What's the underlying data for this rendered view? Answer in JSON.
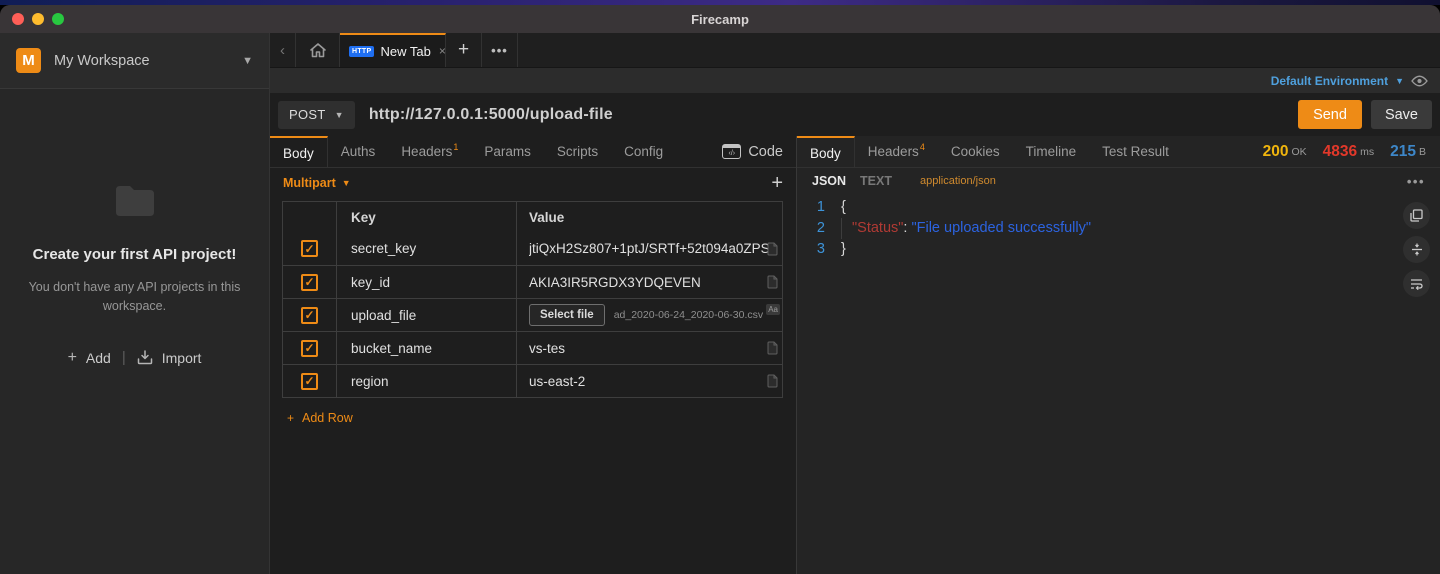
{
  "colors": {
    "accent_orange": "#ee8b16",
    "status_ok_yellow": "#f0b50d",
    "status_time_red": "#e2382a",
    "status_size_blue": "#3d87c9",
    "env_blue": "#4fa0dd",
    "http_badge_blue": "#1f6ff2",
    "json_key_red": "#b03a34",
    "json_string_blue": "#2c63e0",
    "line_number_blue": "#3d93d8"
  },
  "window": {
    "title": "Firecamp"
  },
  "sidebar": {
    "workspace_initial": "M",
    "workspace_name": "My Workspace",
    "empty_title": "Create your first API project!",
    "empty_subtitle": "You don't have any API projects in this workspace.",
    "add_label": "Add",
    "import_label": "Import"
  },
  "tabbar": {
    "active_tab": {
      "badge": "HTTP",
      "label": "New Tab",
      "close": "×"
    }
  },
  "envbar": {
    "selected": "Default Environment"
  },
  "requestbar": {
    "method": "POST",
    "url": "http://127.0.0.1:5000/upload-file",
    "send": "Send",
    "save": "Save"
  },
  "request": {
    "tabs": [
      {
        "label": "Body",
        "active": true
      },
      {
        "label": "Auths"
      },
      {
        "label": "Headers",
        "sup": "1"
      },
      {
        "label": "Params"
      },
      {
        "label": "Scripts"
      },
      {
        "label": "Config"
      }
    ],
    "code_button": "Code",
    "body_type": "Multipart",
    "table": {
      "col_key": "Key",
      "col_value": "Value",
      "rows": [
        {
          "checked": true,
          "key": "secret_key",
          "value": "jtiQxH2Sz807+1ptJ/SRTf+52t094a0ZPS",
          "icon": "doc"
        },
        {
          "checked": true,
          "key": "key_id",
          "value": "AKIA3IR5RGDX3YDQEVEN",
          "icon": "doc"
        },
        {
          "checked": true,
          "key": "upload_file",
          "file_button": "Select file",
          "file_name": "ad_2020-06-24_2020-06-30.csv",
          "icon": "Aa"
        },
        {
          "checked": true,
          "key": "bucket_name",
          "value": "vs-tes",
          "icon": "doc"
        },
        {
          "checked": true,
          "key": "region",
          "value": "us-east-2",
          "icon": "doc"
        }
      ]
    },
    "add_row": "Add Row"
  },
  "response": {
    "tabs": [
      {
        "label": "Body",
        "active": true
      },
      {
        "label": "Headers",
        "sup": "4"
      },
      {
        "label": "Cookies"
      },
      {
        "label": "Timeline"
      },
      {
        "label": "Test Result"
      }
    ],
    "status": {
      "code": "200",
      "code_unit": "OK",
      "time": "4836",
      "time_unit": "ms",
      "size": "215",
      "size_unit": "B"
    },
    "format_active": "JSON",
    "format_alt": "TEXT",
    "content_type": "application/json",
    "code_lines": [
      {
        "num": "1",
        "indent": 0,
        "tokens": [
          {
            "text": "{",
            "type": "plain"
          }
        ]
      },
      {
        "num": "2",
        "indent": 1,
        "tokens": [
          {
            "text": "\"Status\"",
            "type": "key"
          },
          {
            "text": ": ",
            "type": "plain"
          },
          {
            "text": "\"File uploaded successfully\"",
            "type": "string"
          }
        ]
      },
      {
        "num": "3",
        "indent": 0,
        "tokens": [
          {
            "text": "}",
            "type": "plain"
          }
        ]
      }
    ]
  }
}
